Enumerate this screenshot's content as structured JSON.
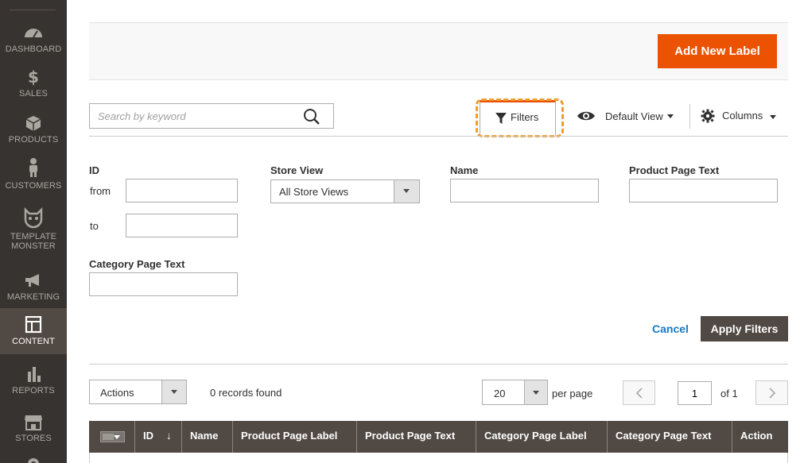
{
  "sidebar": {
    "items": [
      {
        "label": "DASHBOARD",
        "icon": "dashboard-icon"
      },
      {
        "label": "SALES",
        "icon": "dollar-icon"
      },
      {
        "label": "PRODUCTS",
        "icon": "cube-icon"
      },
      {
        "label": "CUSTOMERS",
        "icon": "person-icon"
      },
      {
        "label": "TEMPLATE MONSTER",
        "icon": "monster-icon"
      },
      {
        "label": "MARKETING",
        "icon": "megaphone-icon"
      },
      {
        "label": "CONTENT",
        "icon": "layout-icon",
        "active": true
      },
      {
        "label": "REPORTS",
        "icon": "bar-chart-icon"
      },
      {
        "label": "STORES",
        "icon": "store-icon"
      }
    ]
  },
  "header": {
    "add_button_label": "Add New Label"
  },
  "toolbar": {
    "search_placeholder": "Search by keyword",
    "filters_label": "Filters",
    "view_label": "Default View",
    "columns_label": "Columns"
  },
  "filters": {
    "id_label": "ID",
    "from_label": "from",
    "to_label": "to",
    "store_view_label": "Store View",
    "store_view_value": "All Store Views",
    "name_label": "Name",
    "product_page_text_label": "Product Page Text",
    "category_page_text_label": "Category Page Text",
    "cancel_label": "Cancel",
    "apply_label": "Apply Filters"
  },
  "grid": {
    "actions_label": "Actions",
    "records_text": "0 records found",
    "per_page_value": "20",
    "per_page_label": "per page",
    "current_page": "1",
    "of_pages": "of 1",
    "columns": [
      "ID",
      "Name",
      "Product Page Label",
      "Product Page Text",
      "Category Page Label",
      "Category Page Text",
      "Action"
    ],
    "sort_indicator": "↓"
  },
  "colors": {
    "accent": "#eb5202",
    "highlight": "#ef9d2c",
    "sidebar_bg": "#373330",
    "header_bg": "#514943",
    "link": "#1979c3"
  }
}
